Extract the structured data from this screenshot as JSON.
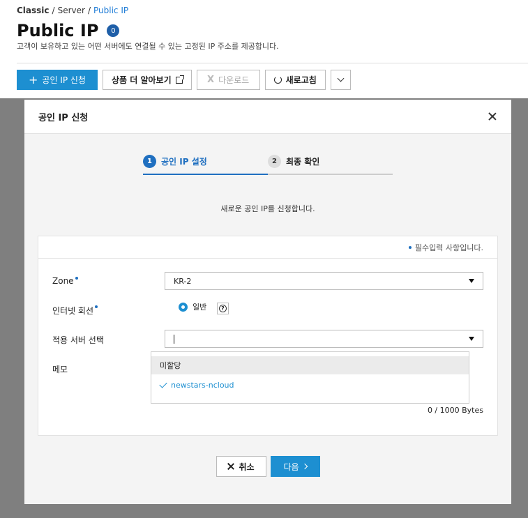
{
  "breadcrumb": {
    "items": [
      "Classic",
      "Server",
      "Public IP"
    ],
    "separator": "/"
  },
  "page": {
    "title": "Public IP",
    "count": "0",
    "description": "고객이 보유하고 있는 어떤 서버에도 연결될 수 있는 고정된 IP 주소를 제공합니다."
  },
  "toolbar": {
    "apply_label": "공인 IP 신청",
    "learn_more_label": "상품 더 알아보기",
    "download_label": "다운로드",
    "refresh_label": "새로고침"
  },
  "modal": {
    "title": "공인 IP 신청",
    "steps": [
      {
        "num": "1",
        "label": "공인 IP 설정",
        "active": true
      },
      {
        "num": "2",
        "label": "최종 확인",
        "active": false
      }
    ],
    "intro": "새로운 공인 IP를 신청합니다.",
    "required_note": "필수입력 사항입니다.",
    "fields": {
      "zone_label": "Zone",
      "zone_value": "KR-2",
      "line_label": "인터넷 회선",
      "line_option": "일반",
      "server_label": "적용 서버 선택",
      "memo_label": "메모",
      "byte_count": "0 / 1000 Bytes"
    },
    "dropdown": {
      "options": [
        "미할당",
        "newstars-ncloud"
      ],
      "selected": "newstars-ncloud"
    },
    "cancel_label": "취소",
    "next_label": "다음"
  },
  "colors": {
    "accent": "#1d8fd1",
    "step_active": "#1f6fc0"
  }
}
